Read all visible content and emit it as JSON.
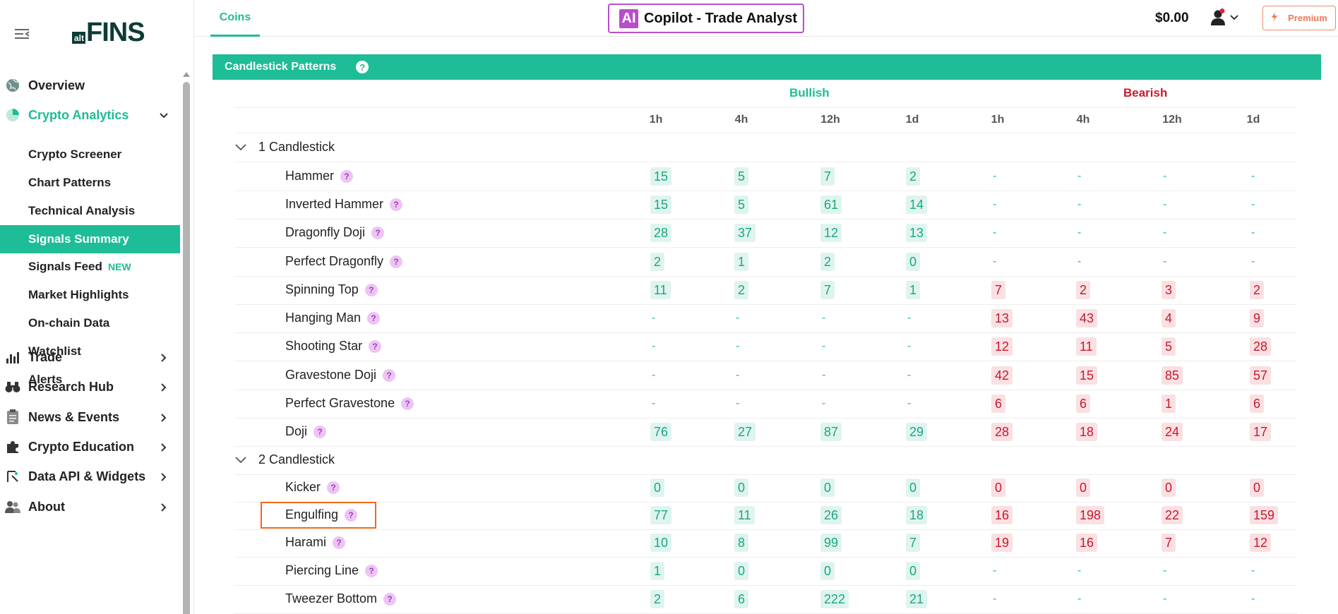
{
  "brand": {
    "alt": "alt",
    "fins": "FINS"
  },
  "sidebar": {
    "items": [
      {
        "label": "Overview",
        "icon": "globe-icon"
      },
      {
        "label": "Crypto Analytics",
        "icon": "pie-chart-icon",
        "expanded": true
      },
      {
        "label": "Trade",
        "icon": "bar-chart-icon"
      },
      {
        "label": "Research Hub",
        "icon": "binoculars-icon"
      },
      {
        "label": "News & Events",
        "icon": "clipboard-icon"
      },
      {
        "label": "Crypto Education",
        "icon": "puzzle-icon"
      },
      {
        "label": "Data API & Widgets",
        "icon": "api-icon"
      },
      {
        "label": "About",
        "icon": "people-icon"
      }
    ],
    "subitems": [
      {
        "label": "Crypto Screener"
      },
      {
        "label": "Chart Patterns"
      },
      {
        "label": "Technical Analysis"
      },
      {
        "label": "Signals Summary",
        "selected": true
      },
      {
        "label": "Signals Feed",
        "badge": "NEW"
      },
      {
        "label": "Market Highlights"
      },
      {
        "label": "On-chain Data"
      },
      {
        "label": "Watchlist"
      },
      {
        "label": "Alerts"
      }
    ]
  },
  "topbar": {
    "tab": "Coins",
    "copilot_badge": "AI",
    "copilot_label": "Copilot - Trade Analyst",
    "balance": "$0.00",
    "premium_label": "Premium"
  },
  "panel": {
    "title": "Candlestick Patterns",
    "help": "?",
    "bullish": "Bullish",
    "bearish": "Bearish",
    "timeframes": [
      "1h",
      "4h",
      "12h",
      "1d",
      "1h",
      "4h",
      "12h",
      "1d"
    ],
    "sections": [
      {
        "title": "1 Candlestick",
        "rows": [
          {
            "name": "Hammer",
            "bull": [
              "15",
              "5",
              "7",
              "2"
            ],
            "bear": [
              "-",
              "-",
              "-",
              "-"
            ]
          },
          {
            "name": "Inverted Hammer",
            "bull": [
              "15",
              "5",
              "61",
              "14"
            ],
            "bear": [
              "-",
              "-",
              "-",
              "-"
            ]
          },
          {
            "name": "Dragonfly Doji",
            "bull": [
              "28",
              "37",
              "12",
              "13"
            ],
            "bear": [
              "-",
              "-",
              "-",
              "-"
            ]
          },
          {
            "name": "Perfect Dragonfly",
            "bull": [
              "2",
              "1",
              "2",
              "0"
            ],
            "bear": [
              "-",
              "-",
              "-",
              "-"
            ]
          },
          {
            "name": "Spinning Top",
            "bull": [
              "11",
              "2",
              "7",
              "1"
            ],
            "bear": [
              "7",
              "2",
              "3",
              "2"
            ]
          },
          {
            "name": "Hanging Man",
            "bull": [
              "-",
              "-",
              "-",
              "-"
            ],
            "bear": [
              "13",
              "43",
              "4",
              "9"
            ]
          },
          {
            "name": "Shooting Star",
            "bull": [
              "-",
              "-",
              "-",
              "-"
            ],
            "bear": [
              "12",
              "11",
              "5",
              "28"
            ]
          },
          {
            "name": "Gravestone Doji",
            "bull": [
              "-",
              "-",
              "-",
              "-"
            ],
            "bear": [
              "42",
              "15",
              "85",
              "57"
            ]
          },
          {
            "name": "Perfect Gravestone",
            "bull": [
              "-",
              "-",
              "-",
              "-"
            ],
            "bear": [
              "6",
              "6",
              "1",
              "6"
            ]
          },
          {
            "name": "Doji",
            "bull": [
              "76",
              "27",
              "87",
              "29"
            ],
            "bear": [
              "28",
              "18",
              "24",
              "17"
            ]
          }
        ]
      },
      {
        "title": "2 Candlestick",
        "rows": [
          {
            "name": "Kicker",
            "bull": [
              "0",
              "0",
              "0",
              "0"
            ],
            "bear": [
              "0",
              "0",
              "0",
              "0"
            ]
          },
          {
            "name": "Engulfing",
            "bull": [
              "77",
              "11",
              "26",
              "18"
            ],
            "bear": [
              "16",
              "198",
              "22",
              "159"
            ]
          },
          {
            "name": "Harami",
            "bull": [
              "10",
              "8",
              "99",
              "7"
            ],
            "bear": [
              "19",
              "16",
              "7",
              "12"
            ]
          },
          {
            "name": "Piercing Line",
            "bull": [
              "1",
              "0",
              "0",
              "0"
            ],
            "bear": [
              "-",
              "-",
              "-",
              "-"
            ]
          },
          {
            "name": "Tweezer Bottom",
            "bull": [
              "2",
              "6",
              "222",
              "21"
            ],
            "bear": [
              "-",
              "-",
              "-",
              "-"
            ]
          }
        ]
      }
    ]
  }
}
